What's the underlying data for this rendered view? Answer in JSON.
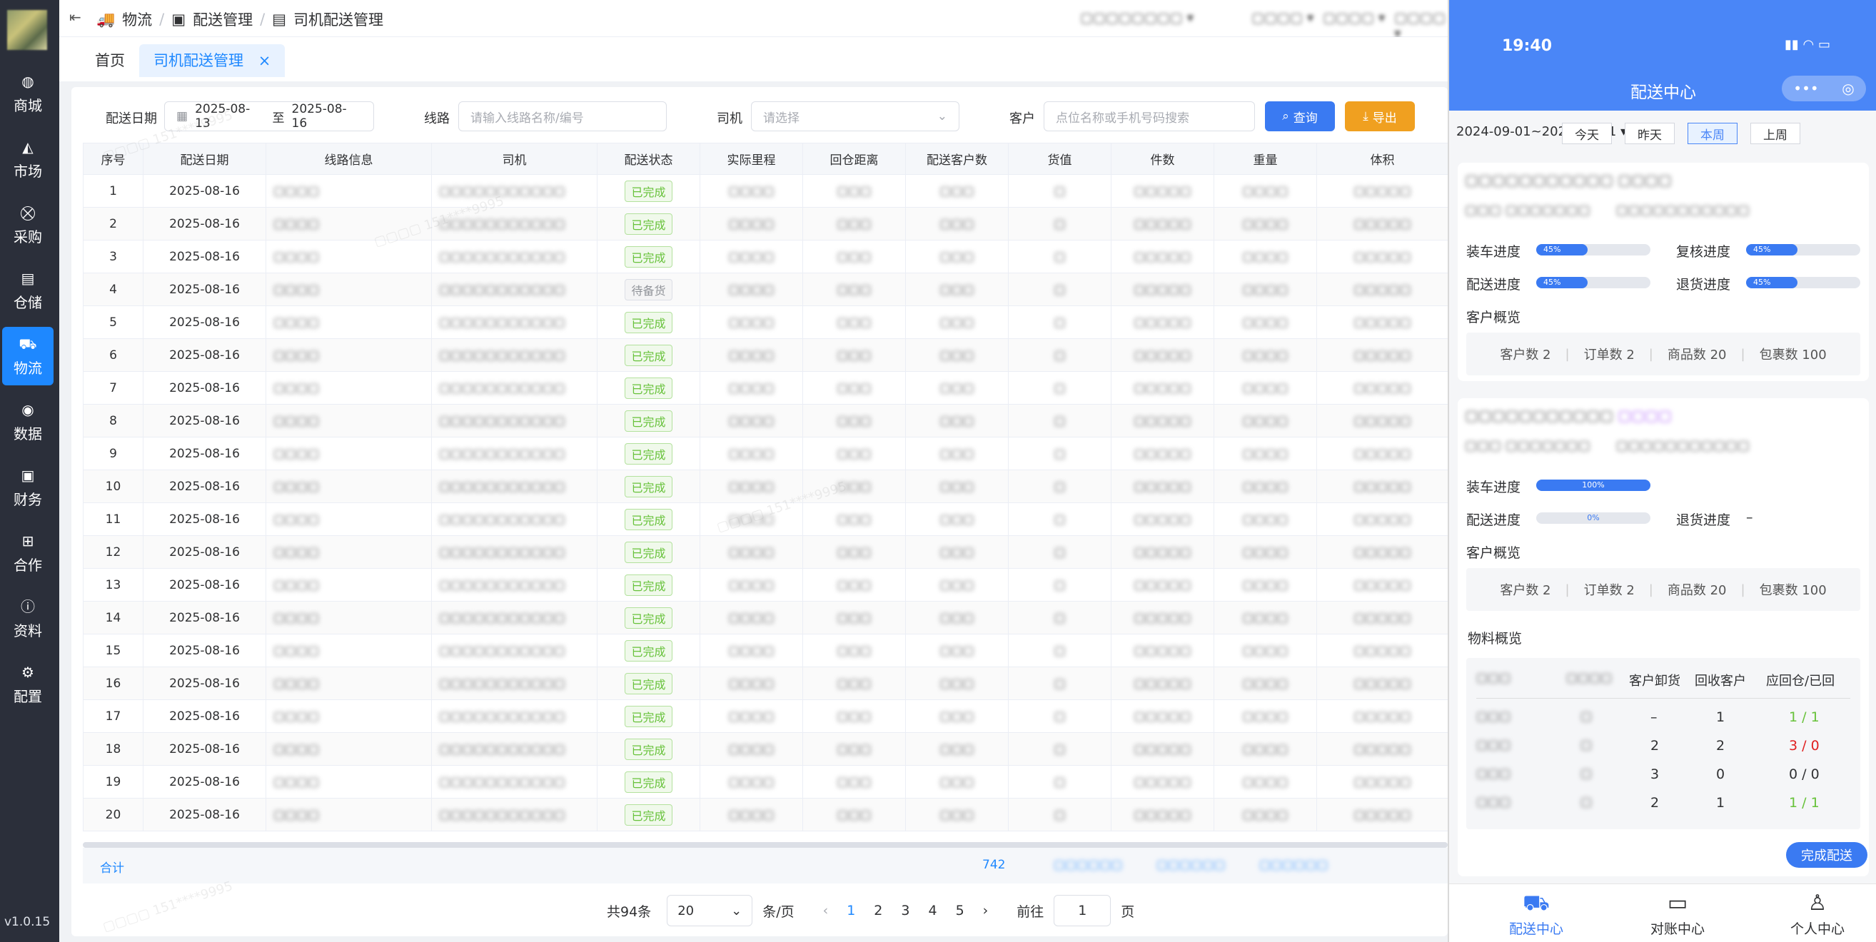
{
  "version": "v1.0.15",
  "sidebar": {
    "items": [
      {
        "label": "商城",
        "icon": "mall-icon"
      },
      {
        "label": "市场",
        "icon": "market-icon"
      },
      {
        "label": "采购",
        "icon": "cart-icon"
      },
      {
        "label": "仓储",
        "icon": "warehouse-icon"
      },
      {
        "label": "物流",
        "icon": "truck-icon",
        "active": true
      },
      {
        "label": "数据",
        "icon": "database-icon"
      },
      {
        "label": "财务",
        "icon": "finance-icon"
      },
      {
        "label": "合作",
        "icon": "cooperate-icon"
      },
      {
        "label": "资料",
        "icon": "info-icon"
      },
      {
        "label": "配置",
        "icon": "config-icon"
      }
    ]
  },
  "breadcrumb": [
    "物流",
    "配送管理",
    "司机配送管理"
  ],
  "tabs": {
    "home": "首页",
    "current": "司机配送管理"
  },
  "filters": {
    "date_label": "配送日期",
    "date_start": "2025-08-13",
    "date_sep": "至",
    "date_end": "2025-08-16",
    "route_label": "线路",
    "route_placeholder": "请输入线路名称/编号",
    "driver_label": "司机",
    "driver_placeholder": "请选择",
    "customer_label": "客户",
    "customer_placeholder": "点位名称或手机号码搜索",
    "query_button": "查询",
    "export_button": "导出"
  },
  "table": {
    "headers": [
      "序号",
      "配送日期",
      "线路信息",
      "司机",
      "配送状态",
      "实际里程",
      "回仓距离",
      "配送客户数",
      "货值",
      "件数",
      "重量",
      "体积"
    ],
    "rows": [
      {
        "no": "1",
        "date": "2025-08-16",
        "status": "已完成"
      },
      {
        "no": "2",
        "date": "2025-08-16",
        "status": "已完成"
      },
      {
        "no": "3",
        "date": "2025-08-16",
        "status": "已完成"
      },
      {
        "no": "4",
        "date": "2025-08-16",
        "status": "待备货"
      },
      {
        "no": "5",
        "date": "2025-08-16",
        "status": "已完成"
      },
      {
        "no": "6",
        "date": "2025-08-16",
        "status": "已完成"
      },
      {
        "no": "7",
        "date": "2025-08-16",
        "status": "已完成"
      },
      {
        "no": "8",
        "date": "2025-08-16",
        "status": "已完成"
      },
      {
        "no": "9",
        "date": "2025-08-16",
        "status": "已完成"
      },
      {
        "no": "10",
        "date": "2025-08-16",
        "status": "已完成"
      },
      {
        "no": "11",
        "date": "2025-08-16",
        "status": "已完成"
      },
      {
        "no": "12",
        "date": "2025-08-16",
        "status": "已完成"
      },
      {
        "no": "13",
        "date": "2025-08-16",
        "status": "已完成"
      },
      {
        "no": "14",
        "date": "2025-08-16",
        "status": "已完成"
      },
      {
        "no": "15",
        "date": "2025-08-16",
        "status": "已完成"
      },
      {
        "no": "16",
        "date": "2025-08-16",
        "status": "已完成"
      },
      {
        "no": "17",
        "date": "2025-08-16",
        "status": "已完成"
      },
      {
        "no": "18",
        "date": "2025-08-16",
        "status": "已完成"
      },
      {
        "no": "19",
        "date": "2025-08-16",
        "status": "已完成"
      },
      {
        "no": "20",
        "date": "2025-08-16",
        "status": "已完成"
      }
    ],
    "sum_label": "合计",
    "sum_customers": "742"
  },
  "pagination": {
    "total": "共94条",
    "page_size": "20",
    "per_page": "条/页",
    "pages": [
      "1",
      "2",
      "3",
      "4",
      "5"
    ],
    "current": "1",
    "goto_label": "前往",
    "goto_value": "1",
    "page_unit": "页"
  },
  "phone": {
    "time": "19:40",
    "title": "配送中心",
    "date_range": "2024-09-01~2024-09-31",
    "quick": [
      "今天",
      "昨天",
      "本周",
      "上周"
    ],
    "quick_active": "本周",
    "card1": {
      "load_label": "装车进度",
      "load_value": "45%",
      "load_fill": 0.45,
      "recheck_label": "复核进度",
      "recheck_value": "45%",
      "recheck_fill": 0.45,
      "deliver_label": "配送进度",
      "deliver_value": "45%",
      "deliver_fill": 0.45,
      "return_label": "退货进度",
      "return_value": "45%",
      "return_fill": 0.45,
      "overview_label": "客户概览",
      "summary": [
        "客户数 2",
        "订单数 2",
        "商品数 20",
        "包裹数 100"
      ]
    },
    "card2": {
      "load_label": "装车进度",
      "load_value": "100%",
      "load_fill": 1.0,
      "deliver_label": "配送进度",
      "deliver_value": "0%",
      "deliver_fill": 0.0,
      "return_label": "退货进度",
      "return_value": "–",
      "overview_label": "客户概览",
      "summary": [
        "客户数 2",
        "订单数 2",
        "商品数 20",
        "包裹数 100"
      ],
      "material_label": "物料概览",
      "material_headers": [
        "客户卸货",
        "回收客户",
        "应回仓/已回"
      ],
      "material_rows": [
        {
          "unload": "–",
          "recycle": "1",
          "ratio": "1 / 1",
          "color": "#67c23a"
        },
        {
          "unload": "2",
          "recycle": "2",
          "ratio": "3 / 0",
          "color": "#e02020"
        },
        {
          "unload": "3",
          "recycle": "0",
          "ratio": "0 / 0",
          "color": "#303133"
        },
        {
          "unload": "2",
          "recycle": "1",
          "ratio": "1 / 1",
          "color": "#67c23a"
        }
      ],
      "finish_button": "完成配送"
    },
    "bottom_nav": [
      "配送中心",
      "对账中心",
      "个人中心"
    ]
  }
}
